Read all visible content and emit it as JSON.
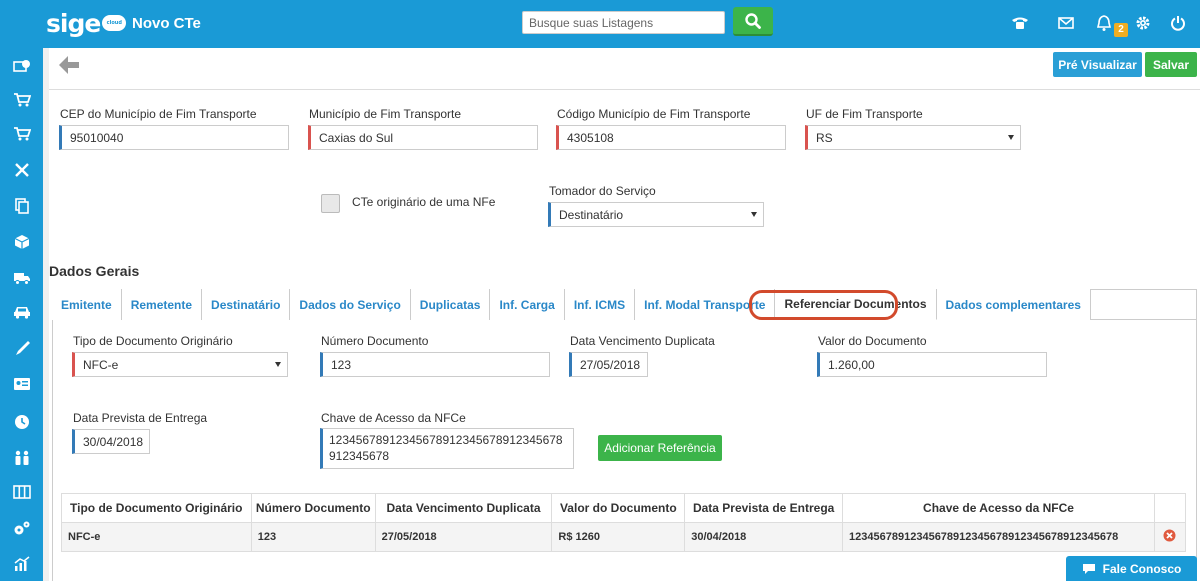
{
  "app": {
    "logo": "sige",
    "logo_sub": "cloud",
    "title": "Novo CTe"
  },
  "search": {
    "placeholder": "Busque suas Listagens"
  },
  "topbar": {
    "notifications_count": "2"
  },
  "toolbar": {
    "preview_label": "Pré Visualizar",
    "save_label": "Salvar"
  },
  "destination": {
    "cep_label": "CEP do Município de Fim Transporte",
    "cep_value": "95010040",
    "municipio_label": "Município de Fim Transporte",
    "municipio_value": "Caxias do Sul",
    "codigo_label": "Código Município de Fim Transporte",
    "codigo_value": "4305108",
    "uf_label": "UF de Fim Transporte",
    "uf_value": "RS"
  },
  "cte": {
    "checkbox_label": "CTe originário de uma NFe",
    "tomador_label": "Tomador do Serviço",
    "tomador_value": "Destinatário"
  },
  "section_title": "Dados Gerais",
  "tabs": [
    {
      "label": "Emitente"
    },
    {
      "label": "Remetente"
    },
    {
      "label": "Destinatário"
    },
    {
      "label": "Dados do Serviço"
    },
    {
      "label": "Duplicatas"
    },
    {
      "label": "Inf. Carga"
    },
    {
      "label": "Inf. ICMS"
    },
    {
      "label": "Inf. Modal Transporte"
    },
    {
      "label": "Referenciar Documentos"
    },
    {
      "label": "Dados complementares"
    }
  ],
  "active_tab": "Referenciar Documentos",
  "form": {
    "tipo_label": "Tipo de Documento Originário",
    "tipo_value": "NFC-e",
    "numero_label": "Número Documento",
    "numero_value": "123",
    "vencimento_label": "Data Vencimento Duplicata",
    "vencimento_value": "27/05/2018",
    "valor_label": "Valor do Documento",
    "valor_value": "1.260,00",
    "entrega_label": "Data Prevista de Entrega",
    "entrega_value": "30/04/2018",
    "chave_label": "Chave de Acesso da NFCe",
    "chave_value": "12345678912345678912345678912345678912345678",
    "add_button": "Adicionar Referência"
  },
  "table": {
    "headers": [
      "Tipo de Documento Originário",
      "Número Documento",
      "Data Vencimento Duplicata",
      "Valor do Documento",
      "Data Prevista de Entrega",
      "Chave de Acesso da NFCe"
    ],
    "rows": [
      [
        "NFC-e",
        "123",
        "27/05/2018",
        "R$ 1260",
        "30/04/2018",
        "12345678912345678912345678912345678912345678"
      ]
    ]
  },
  "chat": {
    "label": "Fale Conosco"
  },
  "colors": {
    "brand": "#1a9ad6",
    "success": "#3cb44a",
    "required": "#d9534f",
    "optional": "#337ab7",
    "highlight": "#d24a2c",
    "badge": "#f0ad22"
  }
}
